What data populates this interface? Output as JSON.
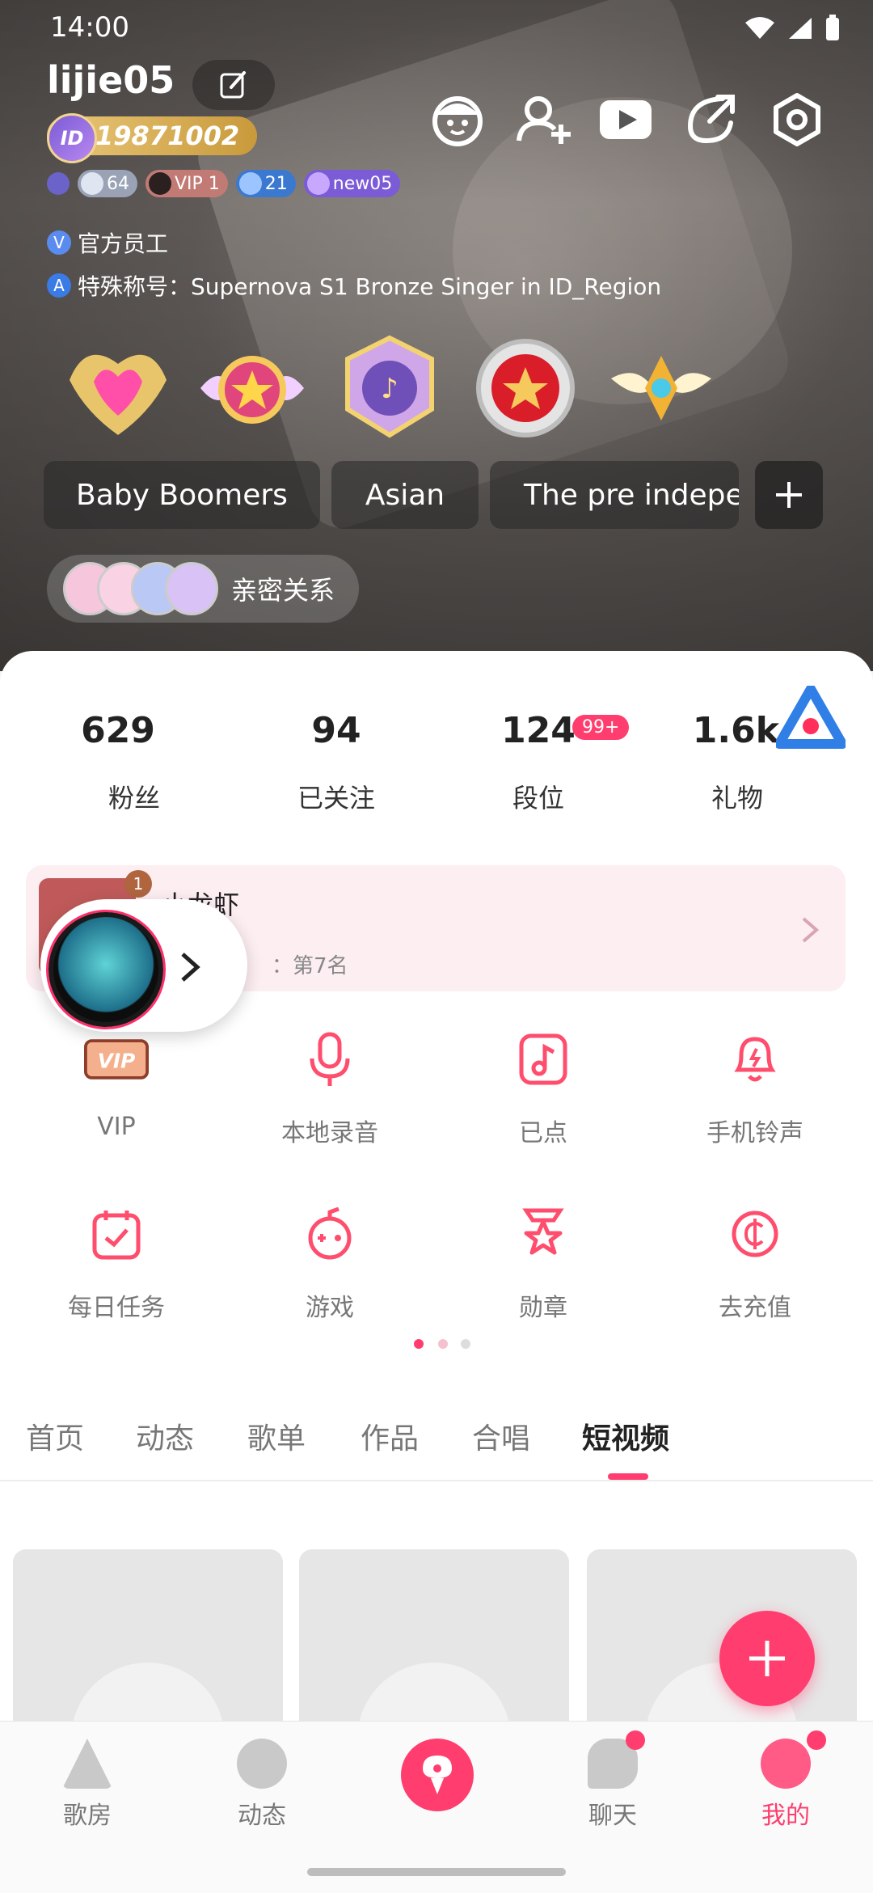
{
  "status_bar": {
    "time": "14:00"
  },
  "profile": {
    "username": "lijie05",
    "id_number": "19871002",
    "levels": [
      {
        "value": "64",
        "color": "#9aa3b5"
      },
      {
        "value": "VIP 1",
        "color": "#c27a74"
      },
      {
        "value": "21",
        "color": "#3b79d0"
      },
      {
        "value": "new05",
        "color": "#7b5bd6"
      }
    ],
    "official_line": "官方员工",
    "special_title_line": "特殊称号：Supernova S1 Bronze Singer in ID_Region",
    "tags": [
      "Baby Boomers",
      "Asian",
      "The pre indepe"
    ],
    "intimacy_label": "亲密关系"
  },
  "stats": [
    {
      "value": "629",
      "label": "粉丝"
    },
    {
      "value": "94",
      "label": "已关注"
    },
    {
      "value": "124",
      "label": "段位",
      "badge": "99+"
    },
    {
      "value": "1.6k",
      "label": "礼物"
    }
  ],
  "rank_card": {
    "title": "小龙虾",
    "subtitle": "：第7名",
    "rank_badge": "1"
  },
  "functions": [
    {
      "label": "VIP",
      "icon": "vip-icon"
    },
    {
      "label": "本地录音",
      "icon": "microphone-icon"
    },
    {
      "label": "已点",
      "icon": "music-note-icon"
    },
    {
      "label": "手机铃声",
      "icon": "bell-icon"
    },
    {
      "label": "每日任务",
      "icon": "calendar-check-icon"
    },
    {
      "label": "游戏",
      "icon": "game-controller-icon"
    },
    {
      "label": "勋章",
      "icon": "medal-icon"
    },
    {
      "label": "去充值",
      "icon": "coin-icon"
    }
  ],
  "tabs": [
    "首页",
    "动态",
    "歌单",
    "作品",
    "合唱",
    "短视频"
  ],
  "active_tab": "短视频",
  "bottom_nav": [
    {
      "label": "歌房"
    },
    {
      "label": "动态"
    },
    {
      "label": "聊天"
    },
    {
      "label": "我的"
    }
  ],
  "colors": {
    "accent": "#ff3d6e"
  }
}
